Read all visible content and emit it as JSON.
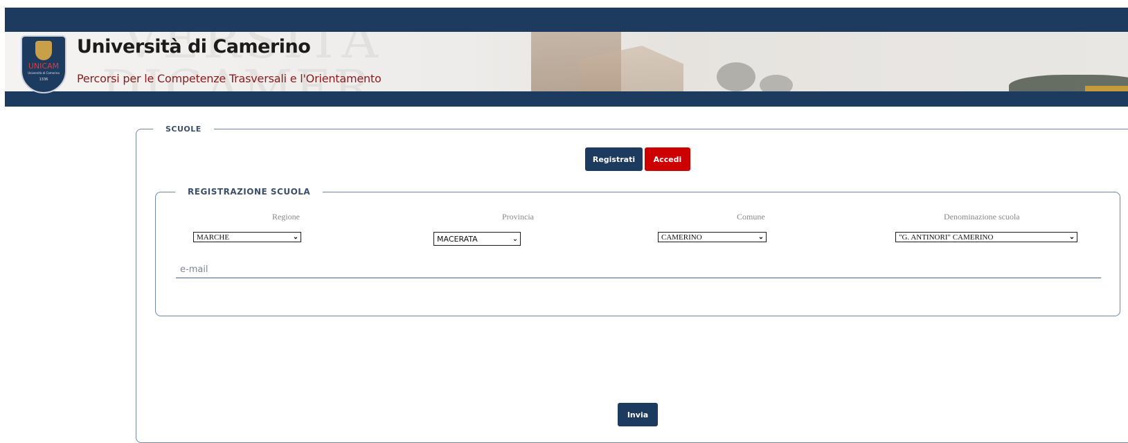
{
  "header": {
    "title": "Università di Camerino",
    "subtitle": "Percorsi per le Competenze Trasversali e l'Orientamento",
    "logo": {
      "text": "UNICAM",
      "subtext": "Università di Camerino",
      "year": "1336"
    }
  },
  "scuole": {
    "legend": "SCUOLE",
    "registrati_label": "Registrati",
    "accedi_label": "Accedi"
  },
  "registrazione": {
    "legend": "REGISTRAZIONE SCUOLA",
    "fields": {
      "regione": {
        "label": "Regione",
        "value": "MARCHE"
      },
      "provincia": {
        "label": "Provincia",
        "value": "MACERATA"
      },
      "comune": {
        "label": "Comune",
        "value": "CAMERINO"
      },
      "scuola": {
        "label": "Denominazione scuola",
        "value": "\"G. ANTINORI\" CAMERINO"
      }
    },
    "email_placeholder": "e-mail"
  },
  "invia_label": "Invia",
  "colors": {
    "primary": "#1d3a5f",
    "accent": "#cc0000",
    "subtitle": "#8c1a1a"
  }
}
